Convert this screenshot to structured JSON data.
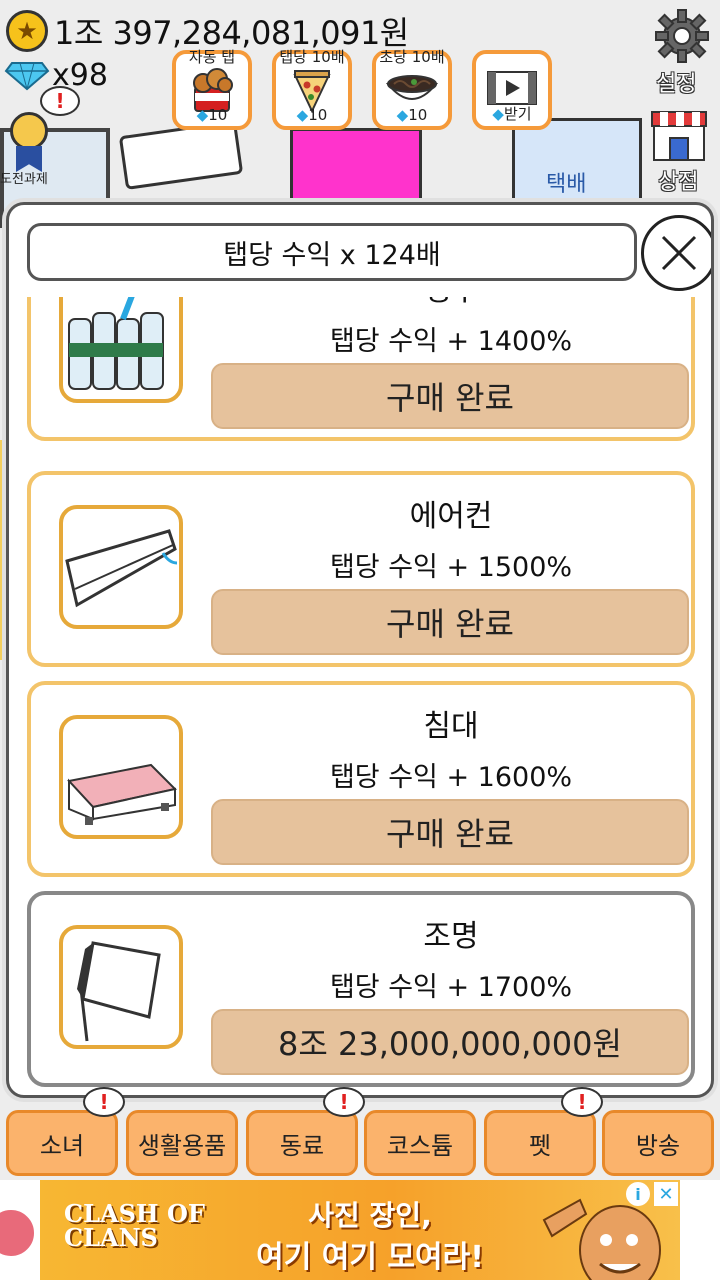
{
  "hud": {
    "money": "1조 397,284,081,091원",
    "gems": "x98",
    "quest_label": "도전과제",
    "alert_mark": "!",
    "settings_label": "설정",
    "shop_label": "상점"
  },
  "boosts": [
    {
      "title": "자동 탭",
      "cost": "10",
      "icon": "fried-chicken-icon"
    },
    {
      "title": "탭당 10배",
      "cost": "10",
      "icon": "pizza-icon"
    },
    {
      "title": "초당 10배",
      "cost": "10",
      "icon": "noodles-icon"
    },
    {
      "title": "",
      "cost": "받기",
      "icon": "video-ad-icon"
    }
  ],
  "background": {
    "box_label": "택배"
  },
  "modal": {
    "title": "탭당 수익 x 124배",
    "close_glyph": "✕",
    "items": [
      {
        "name": "생수",
        "desc": "탭당 수익 + 1400%",
        "button": "구매 완료",
        "state": "purchased"
      },
      {
        "name": "에어컨",
        "desc": "탭당 수익 + 1500%",
        "button": "구매 완료",
        "state": "purchased"
      },
      {
        "name": "침대",
        "desc": "탭당 수익 + 1600%",
        "button": "구매 완료",
        "state": "purchased"
      },
      {
        "name": "조명",
        "desc": "탭당 수익 + 1700%",
        "button": "8조 23,000,000,000원",
        "state": "available"
      }
    ]
  },
  "tabs": [
    {
      "label": "소녀",
      "alert": true
    },
    {
      "label": "생활용품",
      "alert": false
    },
    {
      "label": "동료",
      "alert": true
    },
    {
      "label": "코스튬",
      "alert": false
    },
    {
      "label": "펫",
      "alert": true
    },
    {
      "label": "방송",
      "alert": false
    }
  ],
  "ad": {
    "logo": "CLASH OF CLANS",
    "line1": "사진 장인,",
    "line2": "여기 여기 모여라!",
    "info_glyph": "i",
    "close_glyph": "✕"
  },
  "colors": {
    "accent_orange": "#fbb36c",
    "item_border": "#f3c46a",
    "buy_button": "#e6c29c",
    "gem_blue": "#2aa7e0",
    "alert_red": "#e02020"
  }
}
